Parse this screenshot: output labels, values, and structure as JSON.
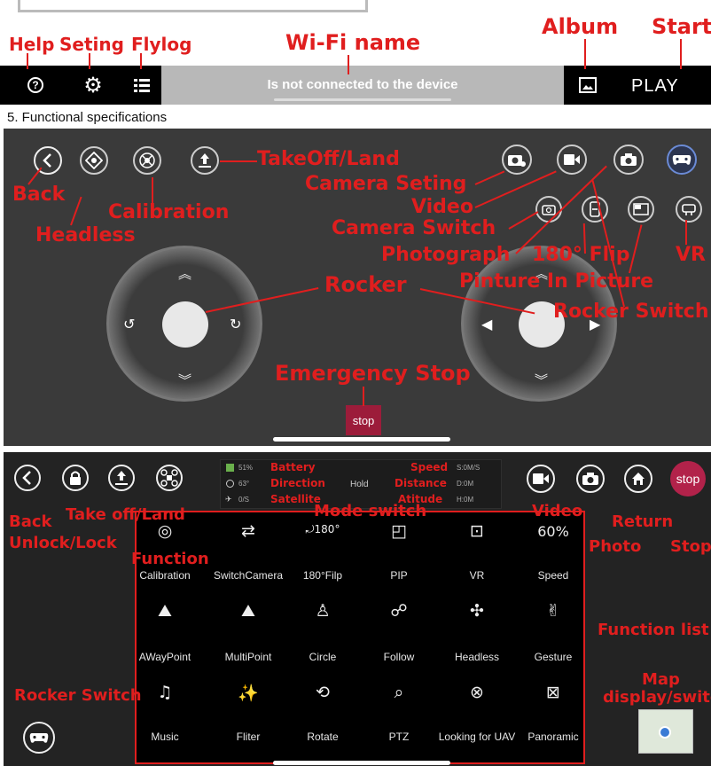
{
  "top": {
    "labels": {
      "help": "Help",
      "setting": "Seting",
      "flylog": "Flylog",
      "wifi": "Wi-Fi name",
      "album": "Album",
      "start": "Start"
    },
    "status_text": "Is not connected to the device",
    "play_label": "PLAY"
  },
  "section_heading": "5. Functional specifications",
  "panel1": {
    "labels": {
      "back": "Back",
      "headless": "Headless",
      "calibration": "Calibration",
      "takeoff": "TakeOff/Land",
      "camera_setting": "Camera Seting",
      "video": "Video",
      "camera_switch": "Camera Switch",
      "photograph": "Photograph",
      "flip": "180° Flip",
      "pip": "Pinture In Picture",
      "vr": "VR",
      "rocker": "Rocker",
      "rocker_switch": "Rocker Switch",
      "emergency": "Emergency Stop"
    },
    "stop_button": "stop"
  },
  "panel2": {
    "status": {
      "battery": "51%",
      "direction": "63°",
      "satellite": "0/S",
      "mode": "Hold",
      "speed": "S:0M/S",
      "distance": "D:0M",
      "altitude": "H:0M"
    },
    "status_labels": {
      "battery": "Battery",
      "direction": "Direction",
      "satellite": "Satellite",
      "speed": "Speed",
      "distance": "Distance",
      "altitude": "Atitude"
    },
    "labels": {
      "back": "Back",
      "unlock": "Unlock/Lock",
      "takeoff": "Take off/Land",
      "function": "Function",
      "mode_switch": "Mode switch",
      "video": "Video",
      "photo": "Photo",
      "return": "Return",
      "stop": "Stop",
      "function_list": "Function list",
      "rocker_switch": "Rocker Switch",
      "map": "Map",
      "map2": "display/switch"
    },
    "stop_button": "stop",
    "speed_value": "60%",
    "functions": [
      [
        "Calibration",
        "SwitchCamera",
        "180°Filp",
        "PIP",
        "VR",
        "Speed"
      ],
      [
        "AWayPoint",
        "MultiPoint",
        "Circle",
        "Follow",
        "Headless",
        "Gesture"
      ],
      [
        "Music",
        "Fliter",
        "Rotate",
        "PTZ",
        "Looking for UAV",
        "Panoramic"
      ]
    ]
  }
}
